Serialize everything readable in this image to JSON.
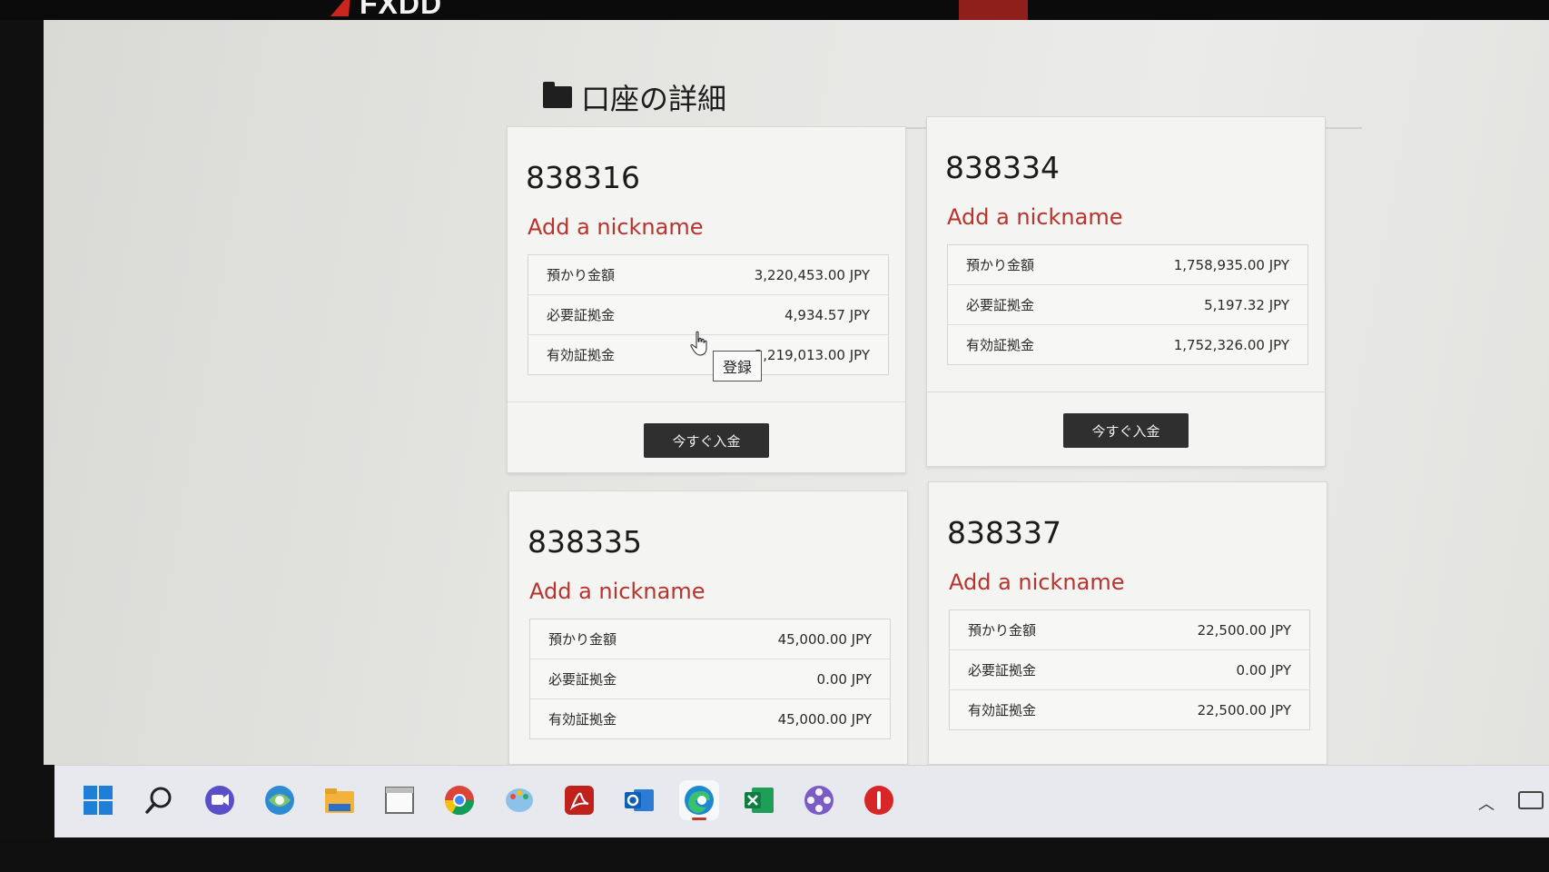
{
  "app": {
    "logo_text": "FXDD"
  },
  "page": {
    "title": "口座の詳細"
  },
  "labels": {
    "balance": "預かり金額",
    "required_margin": "必要証拠金",
    "effective_margin": "有効証拠金"
  },
  "deposit_button_label": "今すぐ入金",
  "nickname_link": "Add a nickname",
  "tooltip": "登録",
  "accounts": [
    {
      "number": "838316",
      "balance": "3,220,453.00 JPY",
      "required_margin": "4,934.57 JPY",
      "effective_margin": "3,219,013.00 JPY"
    },
    {
      "number": "838334",
      "balance": "1,758,935.00 JPY",
      "required_margin": "5,197.32 JPY",
      "effective_margin": "1,752,326.00 JPY"
    },
    {
      "number": "838335",
      "balance": "45,000.00 JPY",
      "required_margin": "0.00 JPY",
      "effective_margin": "45,000.00 JPY"
    },
    {
      "number": "838337",
      "balance": "22,500.00 JPY",
      "required_margin": "0.00 JPY",
      "effective_margin": "22,500.00 JPY"
    }
  ],
  "taskbar": {
    "icons": [
      "windows-start-icon",
      "search-icon",
      "meet-icon",
      "network-icon",
      "file-explorer-icon",
      "window-icon",
      "chrome-icon",
      "paint-icon",
      "acrobat-icon",
      "outlook-icon",
      "edge-icon",
      "excel-icon",
      "media-icon",
      "power-icon"
    ]
  },
  "colors": {
    "accent_red": "#b8332c",
    "button_dark": "#2f2f2f"
  }
}
